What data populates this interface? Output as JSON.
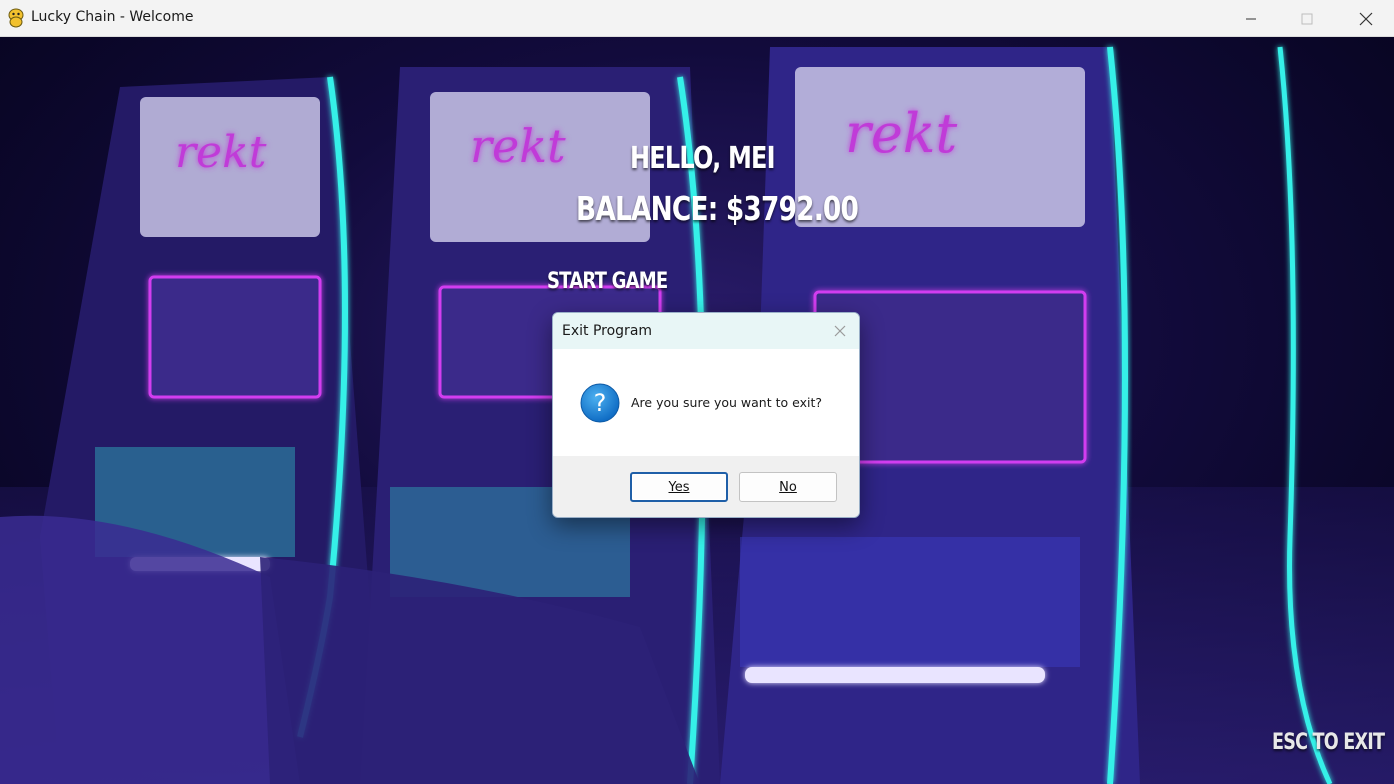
{
  "window": {
    "title": "Lucky Chain - Welcome"
  },
  "hud": {
    "greeting": "HELLO, MEI",
    "balance": "BALANCE: $3792.00",
    "start_game": "START GAME",
    "esc_hint": "ESC TO EXIT"
  },
  "background": {
    "machine_label": "rekt"
  },
  "dialog": {
    "title": "Exit Program",
    "message": "Are you sure you want to exit?",
    "yes_label": "Yes",
    "no_label": "No",
    "icon": "question-icon"
  },
  "colors": {
    "neon_cyan": "#35f0e8",
    "neon_magenta": "#d23cf0",
    "deep_purple": "#1a0f4a",
    "dialog_title_bg": "#e8f6f6",
    "dialog_default_border": "#1f5fa8"
  }
}
